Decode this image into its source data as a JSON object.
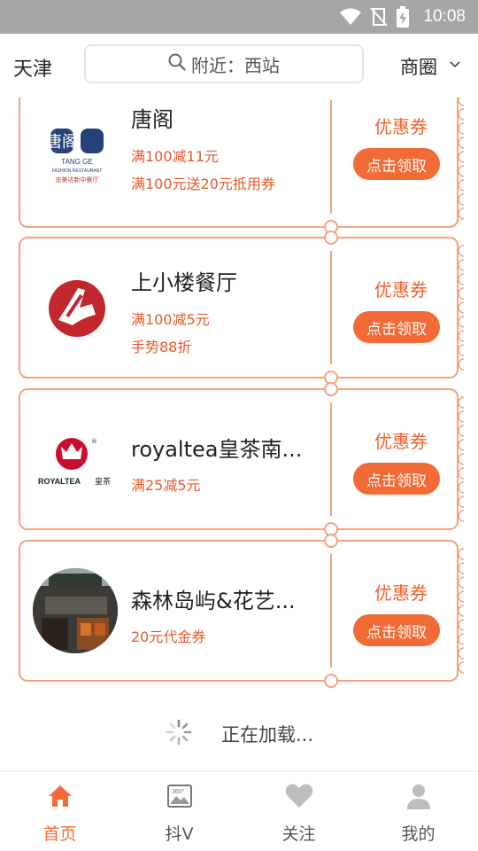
{
  "status_bar": {
    "time": "10:08"
  },
  "header": {
    "city": "天津",
    "search_placeholder": "附近：西站",
    "district": "商圈"
  },
  "coupons": [
    {
      "name": "唐阁",
      "offers": [
        "满100减11元",
        "满100元送20元抵用券"
      ],
      "tag": "优惠券",
      "button": "点击领取",
      "logo_text": [
        "唐阁",
        "TANG GE",
        "FASHION RESTAURANT",
        "忠美达新中餐厅"
      ]
    },
    {
      "name": "上小楼餐厅",
      "offers": [
        "满100减5元",
        "手势88折"
      ],
      "tag": "优惠券",
      "button": "点击领取"
    },
    {
      "name": "royaltea皇茶南...",
      "offers": [
        "满25减5元"
      ],
      "tag": "优惠券",
      "button": "点击领取",
      "logo_text": [
        "ROYALTEA",
        "皇茶"
      ]
    },
    {
      "name": "森林岛屿&花艺...",
      "offers": [
        "20元代金券"
      ],
      "tag": "优惠券",
      "button": "点击领取"
    }
  ],
  "loading_text": "正在加载...",
  "tabs": [
    {
      "label": "首页",
      "icon": "home-icon",
      "active": true
    },
    {
      "label": "抖V",
      "icon": "panorama-360-icon",
      "active": false
    },
    {
      "label": "关注",
      "icon": "heart-icon",
      "active": false
    },
    {
      "label": "我的",
      "icon": "person-icon",
      "active": false
    }
  ],
  "colors": {
    "accent": "#f26a35",
    "border": "#f4a37d",
    "offer_text": "#e8582a",
    "status_bar": "#a6a6a6"
  }
}
